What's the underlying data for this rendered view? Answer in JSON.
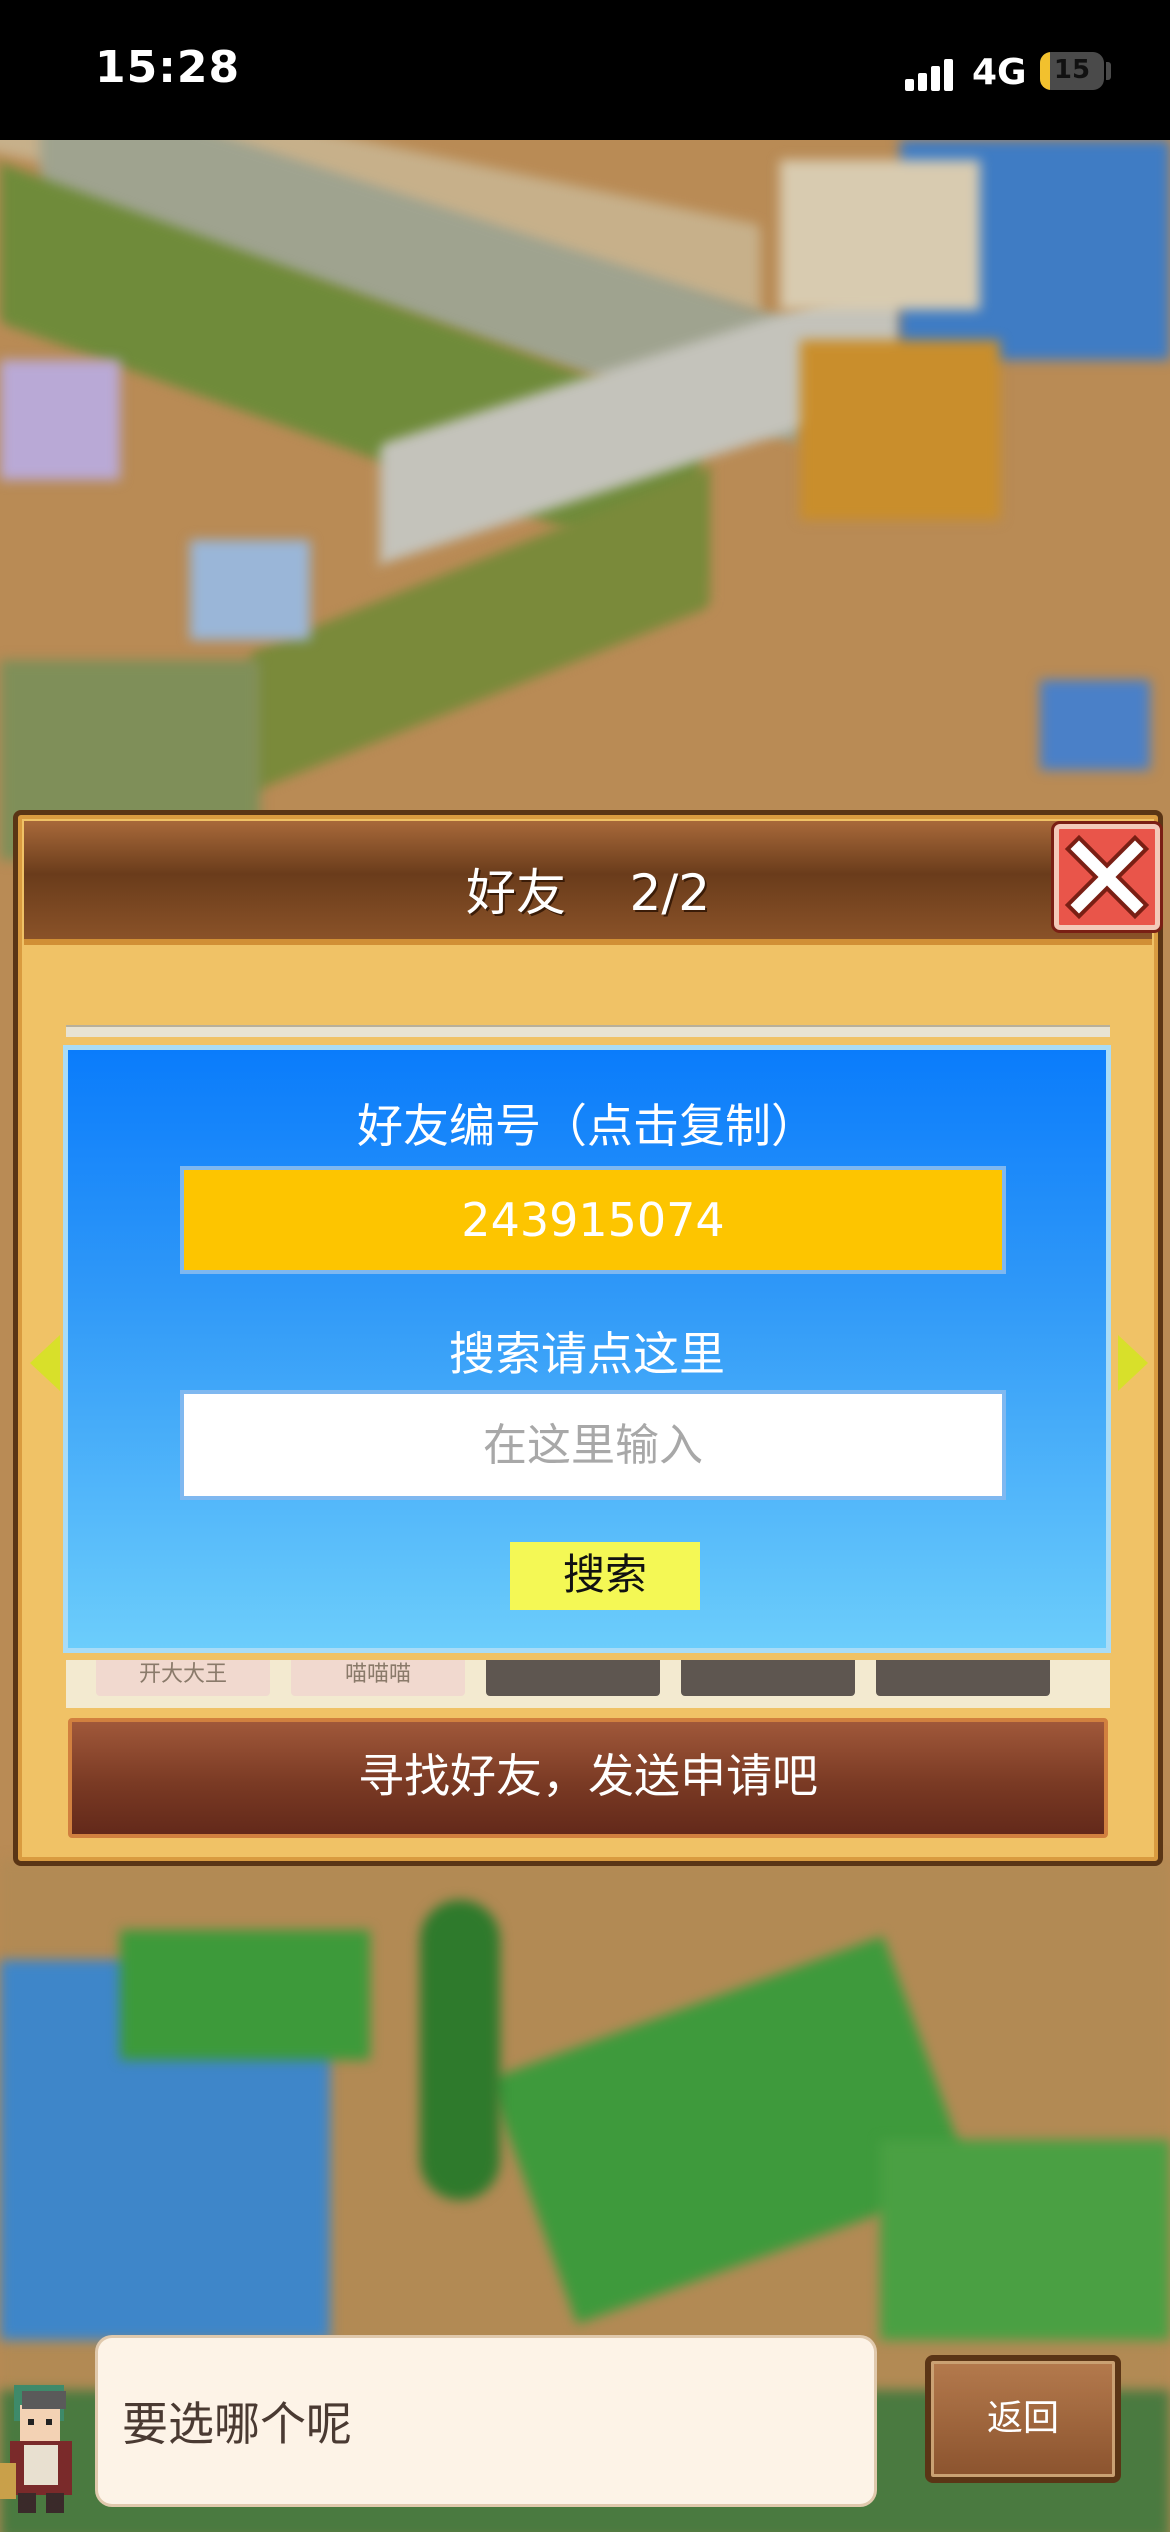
{
  "status_bar": {
    "time": "15:28",
    "network": "4G",
    "battery": "15",
    "battery_level": 0.15
  },
  "dialog": {
    "title": "好友    2/2",
    "close_icon": "close-icon"
  },
  "code_panel": {
    "code_label": "好友编号（点击复制）",
    "friend_code": "243915074",
    "search_label": "搜索请点这里",
    "search_placeholder": "在这里输入",
    "search_button": "搜索"
  },
  "friend_list": {
    "slots": [
      "开大大王",
      "喵喵喵",
      "",
      "",
      ""
    ]
  },
  "find_friends_banner": "寻找好友，发送申请吧",
  "bottom": {
    "speech": "要选哪个呢",
    "back_button": "返回"
  },
  "colors": {
    "accent_yellow": "#fdc500",
    "panel_blue": "#0a7cfb",
    "close_red": "#e9554a"
  }
}
